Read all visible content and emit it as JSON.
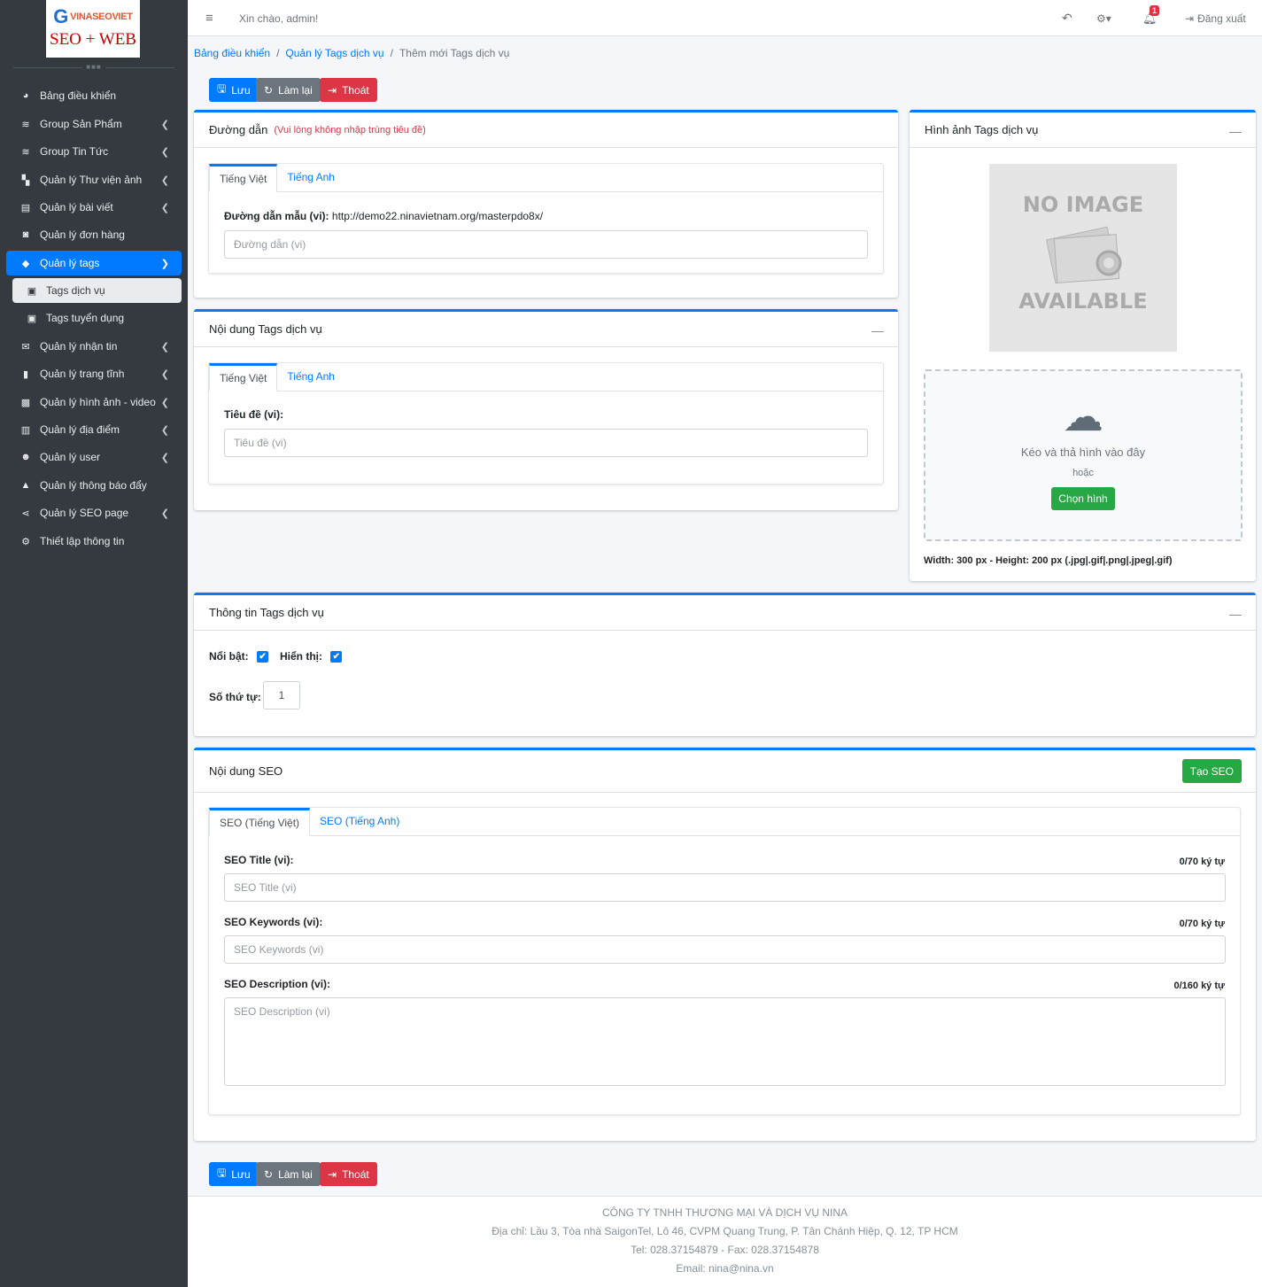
{
  "logo": {
    "brand_top": "VINASEOVIET",
    "brand_g": "G",
    "brand_bottom": "SEO + WEB"
  },
  "sidebar": {
    "items": [
      {
        "label": "Bảng điều khiển",
        "icon": "dashboard-icon"
      },
      {
        "label": "Group Sản Phẩm",
        "icon": "layers-icon"
      },
      {
        "label": "Group Tin Tức",
        "icon": "layers-icon"
      },
      {
        "label": "Quản lý Thư viện ảnh",
        "icon": "boxes-icon"
      },
      {
        "label": "Quản lý bài viết",
        "icon": "newspaper-icon"
      },
      {
        "label": "Quản lý đơn hàng",
        "icon": "shopping-bag-icon"
      },
      {
        "label": "Quản lý tags",
        "icon": "tags-icon"
      },
      {
        "label": "Tags dịch vụ",
        "icon": "square-caret-icon"
      },
      {
        "label": "Tags tuyển dụng",
        "icon": "square-caret-icon"
      },
      {
        "label": "Quản lý nhận tin",
        "icon": "envelope-icon"
      },
      {
        "label": "Quản lý trang tĩnh",
        "icon": "bookmark-icon"
      },
      {
        "label": "Quản lý hình ảnh - video",
        "icon": "photo-video-icon"
      },
      {
        "label": "Quản lý địa điểm",
        "icon": "building-icon"
      },
      {
        "label": "Quản lý user",
        "icon": "users-icon"
      },
      {
        "label": "Quản lý thông báo đẩy",
        "icon": "bell-icon"
      },
      {
        "label": "Quản lý SEO page",
        "icon": "share-icon"
      },
      {
        "label": "Thiết lập thông tin",
        "icon": "cogs-icon"
      }
    ]
  },
  "topbar": {
    "greeting": "Xin chào, admin!",
    "notif_count": "1",
    "logout": "Đăng xuất"
  },
  "breadcrumb": {
    "home": "Bảng điều khiển",
    "parent": "Quản lý Tags dịch vụ",
    "current": "Thêm mới Tags dịch vụ"
  },
  "actions": {
    "save": "Lưu",
    "reset": "Làm lại",
    "exit": "Thoát"
  },
  "slug_card": {
    "title": "Đường dẫn",
    "note": "(Vui lòng không nhập trùng tiêu đề)",
    "tab_vi": "Tiếng Việt",
    "tab_en": "Tiếng Anh",
    "sample_label": "Đường dẫn mẫu (vi):",
    "sample_url": "http://demo22.ninavietnam.org/masterpdo8x/",
    "placeholder": "Đường dẫn (vi)"
  },
  "content_card": {
    "title": "Nội dung Tags dịch vụ",
    "tab_vi": "Tiếng Việt",
    "tab_en": "Tiếng Anh",
    "title_label": "Tiêu đề (vi):",
    "title_placeholder": "Tiêu đề (vi)"
  },
  "image_card": {
    "title": "Hình ảnh Tags dịch vụ",
    "no_image_top": "NO IMAGE",
    "no_image_bottom": "AVAILABLE",
    "drop_text": "Kéo và thả hình vào đây",
    "or_text": "hoặc",
    "choose": "Chọn hình",
    "size_note": "Width: 300 px - Height: 200 px (.jpg|.gif|.png|.jpeg|.gif)"
  },
  "info_card": {
    "title": "Thông tin Tags dịch vụ",
    "featured_label": "Nổi bật:",
    "visible_label": "Hiển thị:",
    "order_label": "Số thứ tự:",
    "order_value": "1"
  },
  "seo_card": {
    "title": "Nội dung SEO",
    "create_button": "Tạo SEO",
    "tab_vi": "SEO (Tiếng Việt)",
    "tab_en": "SEO (Tiếng Anh)",
    "title_label": "SEO Title (vi):",
    "title_count": "0/70 ký tự",
    "title_placeholder": "SEO Title (vi)",
    "keywords_label": "SEO Keywords (vi):",
    "keywords_count": "0/70 ký tự",
    "keywords_placeholder": "SEO Keywords (vi)",
    "desc_label": "SEO Description (vi):",
    "desc_count": "0/160 ký tự",
    "desc_placeholder": "SEO Description (vi)"
  },
  "footer": {
    "company": "CÔNG TY TNHH THƯƠNG MẠI VÀ DỊCH VỤ NINA",
    "address": "Địa chỉ: Lầu 3, Tòa nhà SaigonTel, Lô 46, CVPM Quang Trung, P. Tân Chánh Hiệp, Q. 12, TP HCM",
    "phone": "Tel: 028.37154879 - Fax: 028.37154878",
    "email": "Email: nina@nina.vn"
  },
  "colors": {
    "primary": "#007bff",
    "sidebar": "#343a40",
    "success": "#28a745",
    "danger": "#dc3545",
    "secondary": "#6c757d"
  }
}
